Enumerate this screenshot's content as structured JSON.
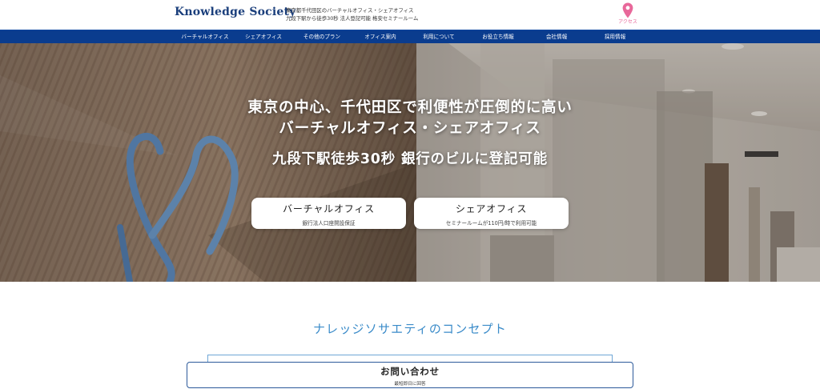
{
  "header": {
    "logo": "Knowledge Society",
    "tagline_line1": "東京都千代田区のバーチャルオフィス・シェアオフィス",
    "tagline_line2": "九段下駅から徒歩30秒 法人登記可能 格安セミナールーム",
    "access_label": "アクセス",
    "access_icon": "map-pin-icon",
    "access_color": "#e8689a"
  },
  "nav": {
    "background": "#0a3c8e",
    "items": [
      {
        "label": "バーチャルオフィス"
      },
      {
        "label": "シェアオフィス"
      },
      {
        "label": "その他のプラン"
      },
      {
        "label": "オフィス案内"
      },
      {
        "label": "利用について"
      },
      {
        "label": "お役立ち情報"
      },
      {
        "label": "会社情報"
      },
      {
        "label": "採用情報"
      }
    ]
  },
  "hero": {
    "line1": "東京の中心、千代田区で利便性が圧倒的に高い",
    "line2": "バーチャルオフィス・シェアオフィス",
    "line3": "九段下駅徒歩30秒 銀行のビルに登記可能",
    "cta_virtual": {
      "title": "バーチャルオフィス",
      "sub": "銀行法人口座開設保証"
    },
    "cta_share": {
      "title": "シェアオフィス",
      "sub": "セミナールームが110円/時で利用可能"
    }
  },
  "concept": {
    "title": "ナレッジソサエティのコンセプト",
    "accent": "#3a8bc9"
  },
  "contact": {
    "title": "お問い合わせ",
    "sub": "最短即日に回答"
  }
}
